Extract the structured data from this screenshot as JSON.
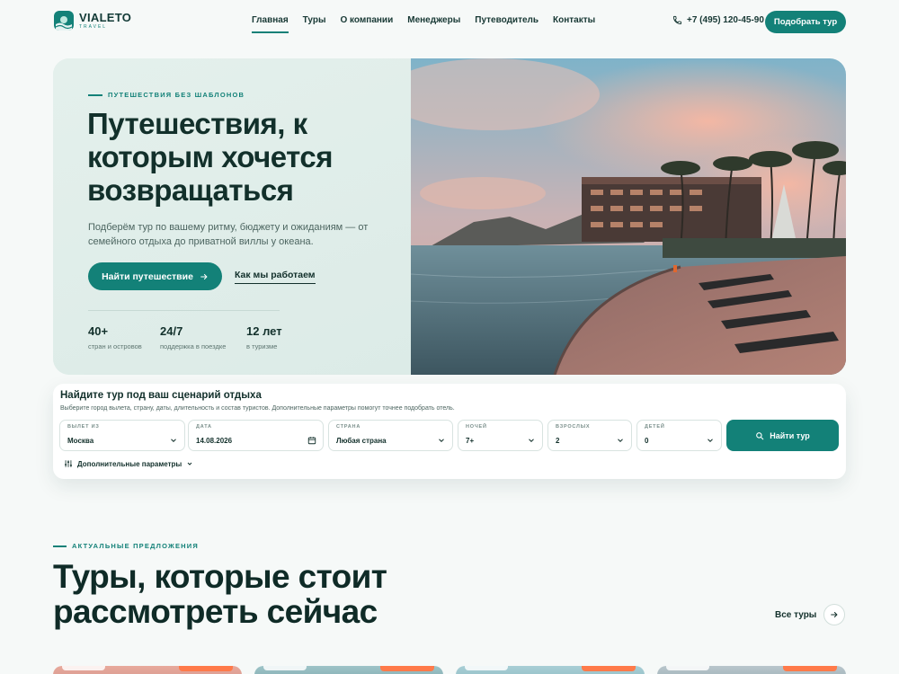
{
  "brand": {
    "name": "VIALETO",
    "sub": "TRAVEL"
  },
  "nav": [
    "Главная",
    "Туры",
    "О компании",
    "Менеджеры",
    "Путеводитель",
    "Контакты"
  ],
  "header": {
    "phone": "+7 (495) 120-45-90",
    "cta": "Подобрать тур"
  },
  "hero": {
    "eyebrow": "ПУТЕШЕСТВИЯ БЕЗ ШАБЛОНОВ",
    "title": "Путешествия, к которым хочется возвращаться",
    "desc": "Подберём тур по вашему ритму, бюджету и ожиданиям — от семейного отдыха до приватной виллы у океана.",
    "primary": "Найти путешествие",
    "secondary": "Как мы работаем",
    "stats": [
      {
        "value": "40+",
        "label": "стран и островов"
      },
      {
        "value": "24/7",
        "label": "поддержка в поездке"
      },
      {
        "value": "12 лет",
        "label": "в туризме"
      }
    ]
  },
  "search": {
    "title": "Найдите тур под ваш сценарий отдыха",
    "subtitle": "Выберите город вылета, страну, даты, длительность и состав туристов. Дополнительные параметры помогут точнее подобрать отель.",
    "fields": [
      {
        "label": "ВЫЛЕТ ИЗ",
        "value": "Москва"
      },
      {
        "label": "ДАТА",
        "value": "14.08.2026"
      },
      {
        "label": "СТРАНА",
        "value": "Любая страна"
      },
      {
        "label": "НОЧЕЙ",
        "value": "7+"
      },
      {
        "label": "ВЗРОСЛЫХ",
        "value": "2"
      },
      {
        "label": "ДЕТЕЙ",
        "value": "0"
      }
    ],
    "button": "Найти тур",
    "extra": "Дополнительные параметры"
  },
  "offers": {
    "eyebrow": "АКТУАЛЬНЫЕ ПРЕДЛОЖЕНИЯ",
    "title": "Туры, которые стоит рассмотреть сейчас",
    "all": "Все туры"
  },
  "colors": {
    "accent": "#138178",
    "dark": "#12302b",
    "badge": "#ff7a4a"
  }
}
